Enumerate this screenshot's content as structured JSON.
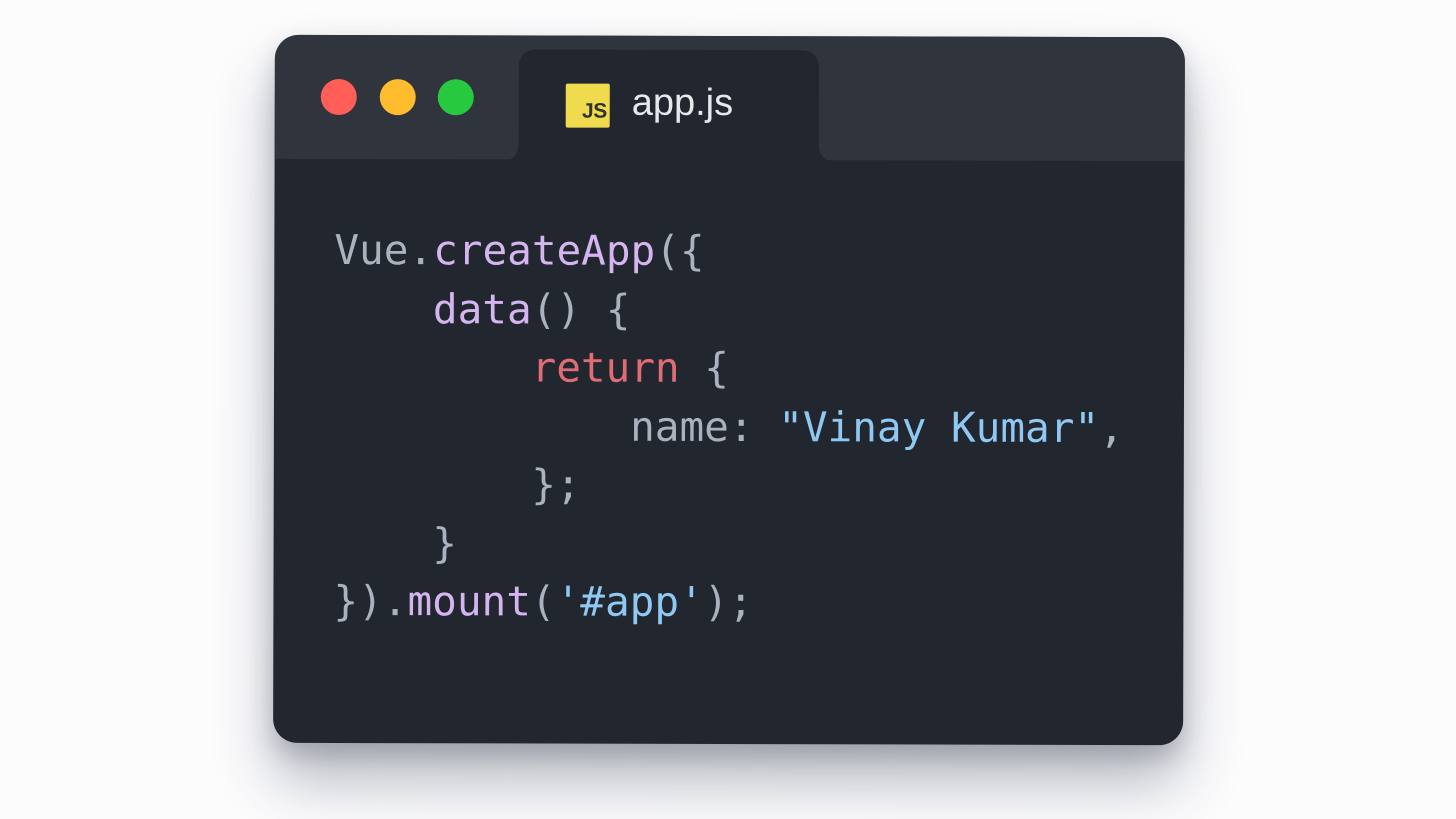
{
  "colors": {
    "page_background": "#fcfcfd",
    "window_background": "#22262e",
    "titlebar_background": "#30343c",
    "close": "#ff5f56",
    "minimize": "#ffbd2e",
    "maximize": "#27c93f",
    "js_badge_background": "#f0db4f",
    "js_badge_text": "#323330",
    "syntax": {
      "plain": "#abb2bf",
      "function": "#d4b5f0",
      "keyword": "#e06c75",
      "string": "#8fc8f2"
    }
  },
  "window": {
    "controls": [
      {
        "name": "close-button",
        "icon": "red-circle-icon",
        "color_key": "close"
      },
      {
        "name": "minimize-button",
        "icon": "yellow-circle-icon",
        "color_key": "minimize"
      },
      {
        "name": "maximize-button",
        "icon": "green-circle-icon",
        "color_key": "maximize"
      }
    ]
  },
  "tab": {
    "icon": "javascript-file-icon",
    "icon_text": "JS",
    "filename": "app.js"
  },
  "code": {
    "language": "javascript",
    "indent": "    ",
    "lines": [
      {
        "indent_level": 0,
        "tokens": [
          {
            "text": "Vue.",
            "type": "plain"
          },
          {
            "text": "createApp",
            "type": "function"
          },
          {
            "text": "({",
            "type": "plain"
          }
        ]
      },
      {
        "indent_level": 1,
        "tokens": [
          {
            "text": "data",
            "type": "function"
          },
          {
            "text": "() {",
            "type": "plain"
          }
        ]
      },
      {
        "indent_level": 2,
        "tokens": [
          {
            "text": "return",
            "type": "keyword"
          },
          {
            "text": " {",
            "type": "plain"
          }
        ]
      },
      {
        "indent_level": 3,
        "tokens": [
          {
            "text": "name: ",
            "type": "plain"
          },
          {
            "text": "\"Vinay Kumar\"",
            "type": "string"
          },
          {
            "text": ",",
            "type": "plain"
          }
        ]
      },
      {
        "indent_level": 2,
        "tokens": [
          {
            "text": "};",
            "type": "plain"
          }
        ]
      },
      {
        "indent_level": 1,
        "tokens": [
          {
            "text": "}",
            "type": "plain"
          }
        ]
      },
      {
        "indent_level": 0,
        "tokens": [
          {
            "text": "}).",
            "type": "plain"
          },
          {
            "text": "mount",
            "type": "function"
          },
          {
            "text": "(",
            "type": "plain"
          },
          {
            "text": "'#app'",
            "type": "string"
          },
          {
            "text": ");",
            "type": "plain"
          }
        ]
      }
    ]
  }
}
